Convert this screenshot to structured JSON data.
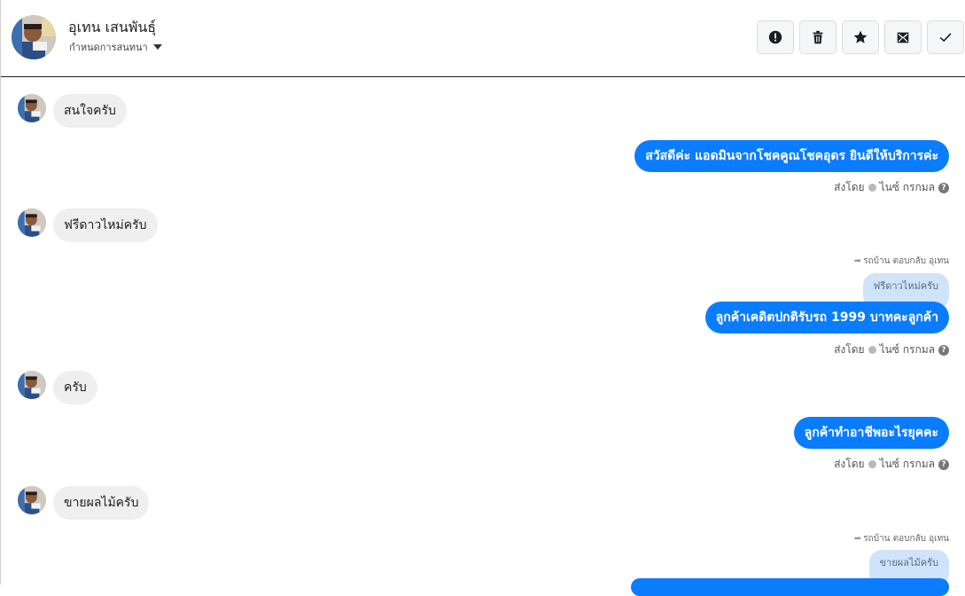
{
  "header": {
    "contact_name": "อุเทน เสนพันธุ์",
    "assign_label": "กำหนดการสนทนา",
    "actions": [
      {
        "name": "spam-button",
        "icon": "exclamation-icon"
      },
      {
        "name": "delete-button",
        "icon": "trash-icon"
      },
      {
        "name": "star-button",
        "icon": "star-icon"
      },
      {
        "name": "mark-unread-button",
        "icon": "envelope-icon"
      },
      {
        "name": "mark-done-button",
        "icon": "check-icon"
      }
    ]
  },
  "colors": {
    "outgoing_bubble": "#0a7cff",
    "incoming_bubble": "#efefef",
    "quoted_bubble": "#cfe3fb"
  },
  "messages": [
    {
      "direction": "in",
      "text": "สนใจครับ"
    },
    {
      "direction": "out",
      "text": "สวัสดีค่ะ แอดมินจากโชคคูณโชคอุดร ยินดีให้บริการค่ะ",
      "sent_by_label": "ส่งโดย",
      "sender": "ไนซ์ กรกมล"
    },
    {
      "direction": "in",
      "text": "ฟรีดาวไหม่ครับ"
    },
    {
      "direction": "out",
      "reply_note": "รถบ้าน ตอบกลับ อุเทน",
      "quoted_text": "ฟรีดาวไหม่ครับ",
      "text": "ลูกค้าเคดิตปกติรับรถ 1999 บาทคะลูกค้า",
      "sent_by_label": "ส่งโดย",
      "sender": "ไนซ์ กรกมล"
    },
    {
      "direction": "in",
      "text": "ครับ"
    },
    {
      "direction": "out",
      "text": "ลูกค้าทำอาชีพอะไรยุคคะ",
      "sent_by_label": "ส่งโดย",
      "sender": "ไนซ์ กรกมล"
    },
    {
      "direction": "in",
      "text": "ขายผลไม้ครับ"
    },
    {
      "direction": "out",
      "reply_note": "รถบ้าน ตอบกลับ อุเทน",
      "quoted_text": "ขายผลไม้ครับ"
    }
  ]
}
